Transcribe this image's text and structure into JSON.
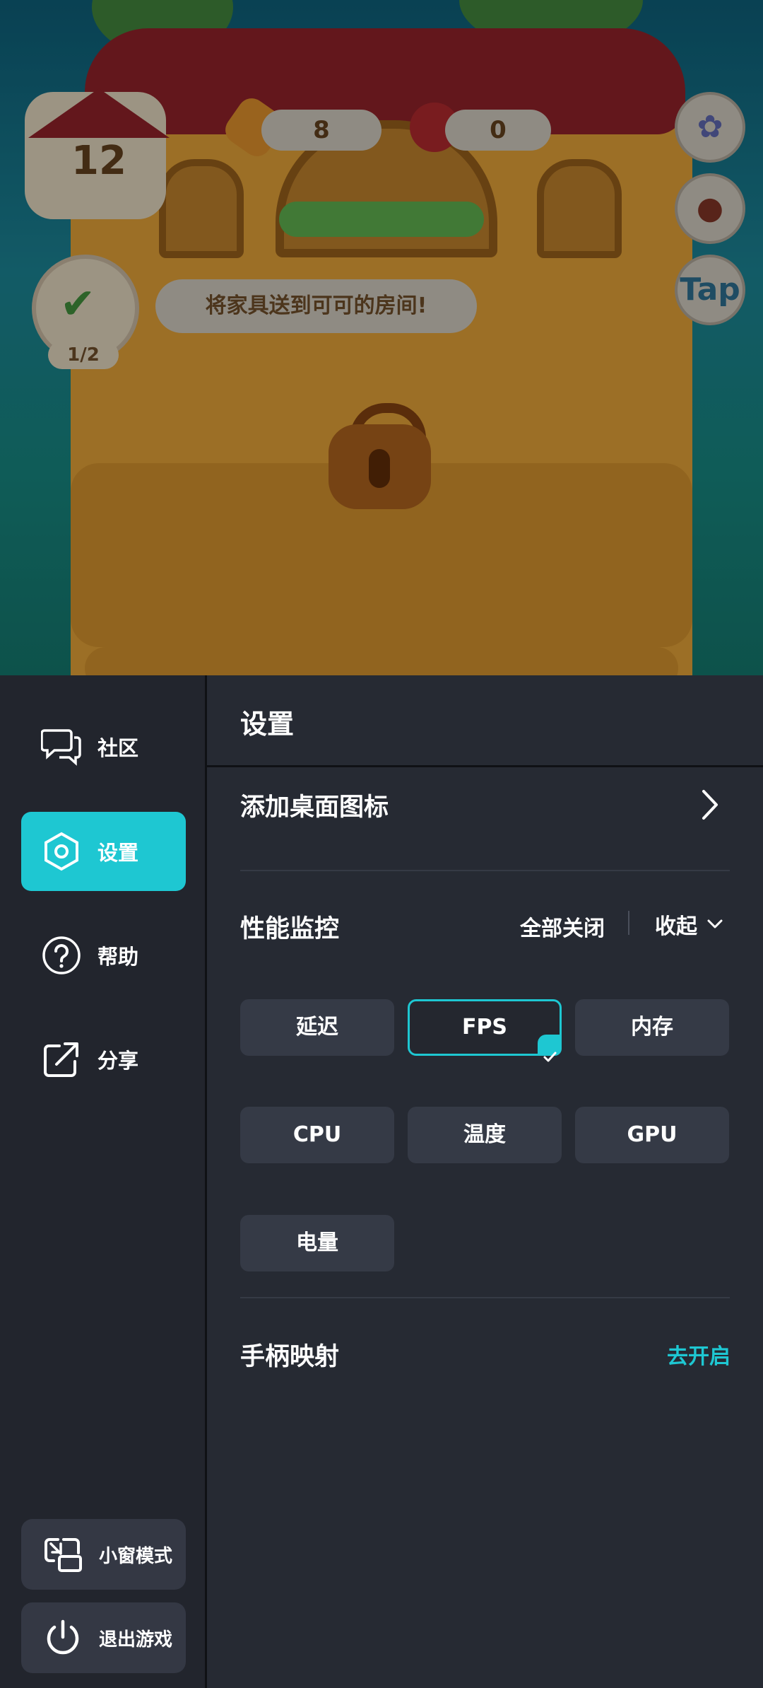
{
  "game": {
    "level": "12",
    "pencils": "8",
    "cans": "0",
    "quest_text": "将家具送到可可的房间!",
    "quest_progress": "1/2",
    "tap_label": "Tap"
  },
  "sidebar": {
    "items": [
      {
        "label": "社区",
        "icon": "chat-icon"
      },
      {
        "label": "设置",
        "icon": "hexagon-settings-icon"
      },
      {
        "label": "帮助",
        "icon": "help-icon"
      },
      {
        "label": "分享",
        "icon": "share-icon"
      }
    ],
    "active_index": 1,
    "bottom": {
      "window_mode": "小窗模式",
      "exit_game": "退出游戏"
    }
  },
  "main": {
    "title": "设置",
    "add_shortcut": "添加桌面图标",
    "perf_monitor": {
      "title": "性能监控",
      "close_all": "全部关闭",
      "collapse": "收起",
      "metrics": [
        {
          "label": "延迟",
          "selected": false
        },
        {
          "label": "FPS",
          "selected": true
        },
        {
          "label": "内存",
          "selected": false
        },
        {
          "label": "CPU",
          "selected": false
        },
        {
          "label": "温度",
          "selected": false
        },
        {
          "label": "GPU",
          "selected": false
        },
        {
          "label": "电量",
          "selected": false
        }
      ]
    },
    "controller": {
      "title": "手柄映射",
      "action": "去开启"
    }
  },
  "colors": {
    "accent": "#1ec7d2",
    "panel_bg": "#262a33",
    "sidebar_bg": "#22252d",
    "chip_bg": "#353a46"
  }
}
